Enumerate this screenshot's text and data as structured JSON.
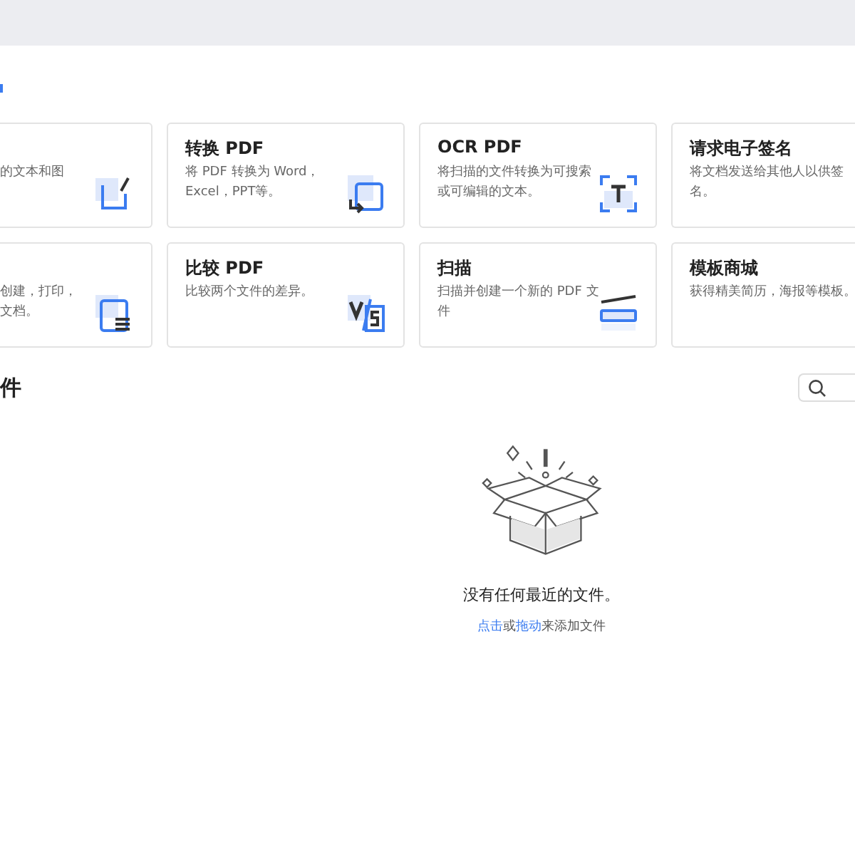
{
  "tools": [
    {
      "description": "的文本和图"
    },
    {
      "title": "转换 PDF",
      "description": "将 PDF 转换为 Word，Excel，PPT等。"
    },
    {
      "title": "OCR PDF",
      "description": "将扫描的文件转换为可搜索或可编辑的文本。"
    },
    {
      "title": "请求电子签名",
      "description": "将文档发送给其他人以供签名。"
    },
    {
      "description": "创建，打印，文档。"
    },
    {
      "title": "比较 PDF",
      "description": "比较两个文件的差异。"
    },
    {
      "title": "扫描",
      "description": "扫描并创建一个新的 PDF 文件"
    },
    {
      "title": "模板商城",
      "description": "获得精美简历，海报等模板。"
    }
  ],
  "recent": {
    "title": "件",
    "empty_message": "没有任何最近的文件。",
    "hint": [
      {
        "text": "点击",
        "kind": "link"
      },
      {
        "text": "或",
        "kind": "text"
      },
      {
        "text": "拖动",
        "kind": "link"
      },
      {
        "text": "来添加文件",
        "kind": "text"
      }
    ]
  }
}
